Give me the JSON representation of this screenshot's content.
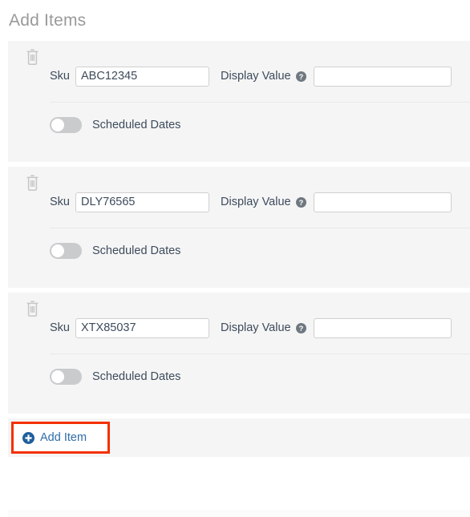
{
  "page": {
    "title": "Add Items"
  },
  "labels": {
    "sku": "Sku",
    "display_value": "Display Value",
    "scheduled_dates": "Scheduled Dates",
    "delete_icon": "trash-icon",
    "help_icon": "help-circle-icon",
    "toggle_state": "off"
  },
  "items": [
    {
      "sku_value": "ABC12345",
      "sku_placeholder": "",
      "display_value": "",
      "display_placeholder": "",
      "scheduled_dates_label": "Scheduled Dates",
      "scheduled_dates_on": false
    },
    {
      "sku_value": "DLY76565",
      "sku_placeholder": "",
      "display_value": "",
      "display_placeholder": "",
      "scheduled_dates_label": "Scheduled Dates",
      "scheduled_dates_on": false
    },
    {
      "sku_value": "XTX85037",
      "sku_placeholder": "",
      "display_value": "",
      "display_placeholder": "",
      "scheduled_dates_label": "Scheduled Dates",
      "scheduled_dates_on": false
    }
  ],
  "footer": {
    "add_item_label": "Add Item",
    "add_item_icon": "plus-circle-icon"
  },
  "colors": {
    "card_background": "#f5f5f5",
    "page_background": "#ffffff",
    "heading_text": "#9a9a9a",
    "body_text": "#3d4b5c",
    "link_blue": "#2f6da8",
    "highlight_red": "#f43000",
    "toggle_off": "#c9cbcd",
    "input_border": "#cfcfcf",
    "icon_gray": "#c6c6c6",
    "help_icon_gray": "#6f7880"
  }
}
